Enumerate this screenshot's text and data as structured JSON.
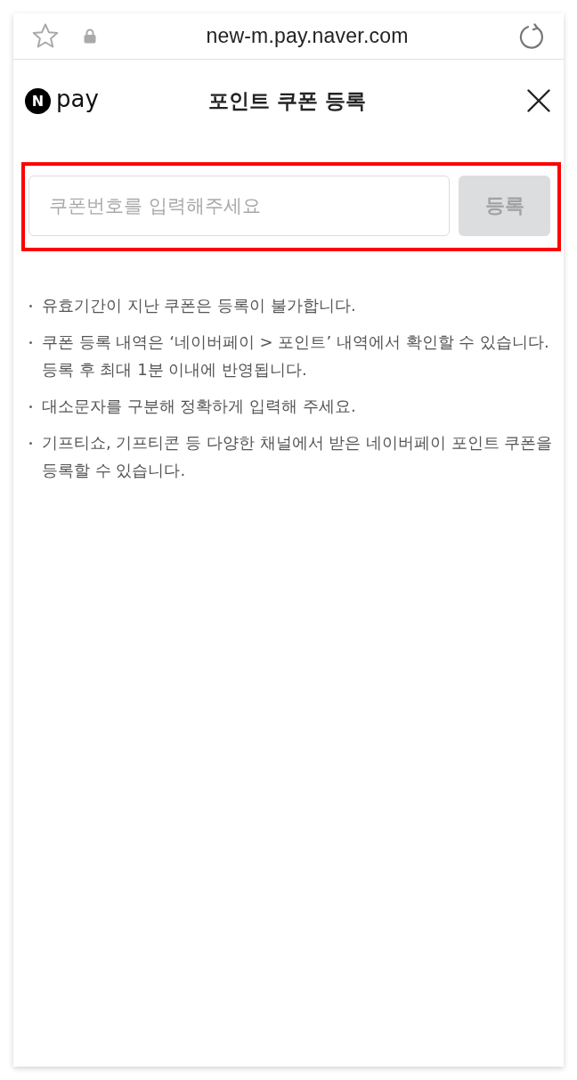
{
  "browser": {
    "url": "new-m.pay.naver.com"
  },
  "header": {
    "logo": {
      "badge": "N",
      "text": "pay"
    },
    "title": "포인트 쿠폰 등록"
  },
  "coupon_form": {
    "highlighted": true,
    "input": {
      "placeholder": "쿠폰번호를 입력해주세요"
    },
    "button": {
      "label": "등록",
      "disabled": true
    }
  },
  "notes": [
    "유효기간이 지난 쿠폰은 등록이 불가합니다.",
    "쿠폰 등록 내역은 ‘네이버페이 > 포인트’ 내역에서 확인할 수 있습니다. 등록 후 최대 1분 이내에 반영됩니다.",
    "대소문자를 구분해 정확하게 입력해 주세요.",
    "기프티쇼, 기프티콘 등 다양한 채널에서 받은 네이버페이 포인트 쿠폰을 등록할 수 있습니다."
  ]
}
